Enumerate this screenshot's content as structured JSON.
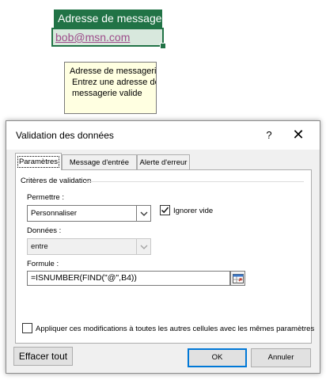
{
  "sheet": {
    "header_cell": "Adresse de messagerie",
    "email_cell": "bob@msn.com"
  },
  "tooltip": {
    "title": "Adresse de messagerie",
    "body": "Entrez une adresse de\nmessagerie valide"
  },
  "dialog": {
    "title": "Validation des données",
    "help_label": "?",
    "close_label": "✕",
    "tabs": [
      "Paramètres",
      "Message d'entrée",
      "Alerte d'erreur"
    ],
    "criteria_label": "Critères de validation",
    "allow": {
      "label": "Permettre :",
      "value": "Personnaliser"
    },
    "ignore_blank": {
      "label": "Ignorer vide",
      "checked": true
    },
    "data": {
      "label": "Données :",
      "value": "entre"
    },
    "formula": {
      "label": "Formule :",
      "value": "=ISNUMBER(FIND(\"@\",B4))"
    },
    "apply_all": {
      "label": "Appliquer ces modifications à toutes les autres cellules avec les mêmes paramètres",
      "checked": false
    },
    "buttons": {
      "clear": "Effacer tout",
      "ok": "OK",
      "cancel": "Annuler"
    }
  },
  "colors": {
    "excel_green": "#217346",
    "tooltip_bg": "#ffffe1",
    "hyperlink": "#9d4c8a",
    "focus_blue": "#0078d7"
  }
}
